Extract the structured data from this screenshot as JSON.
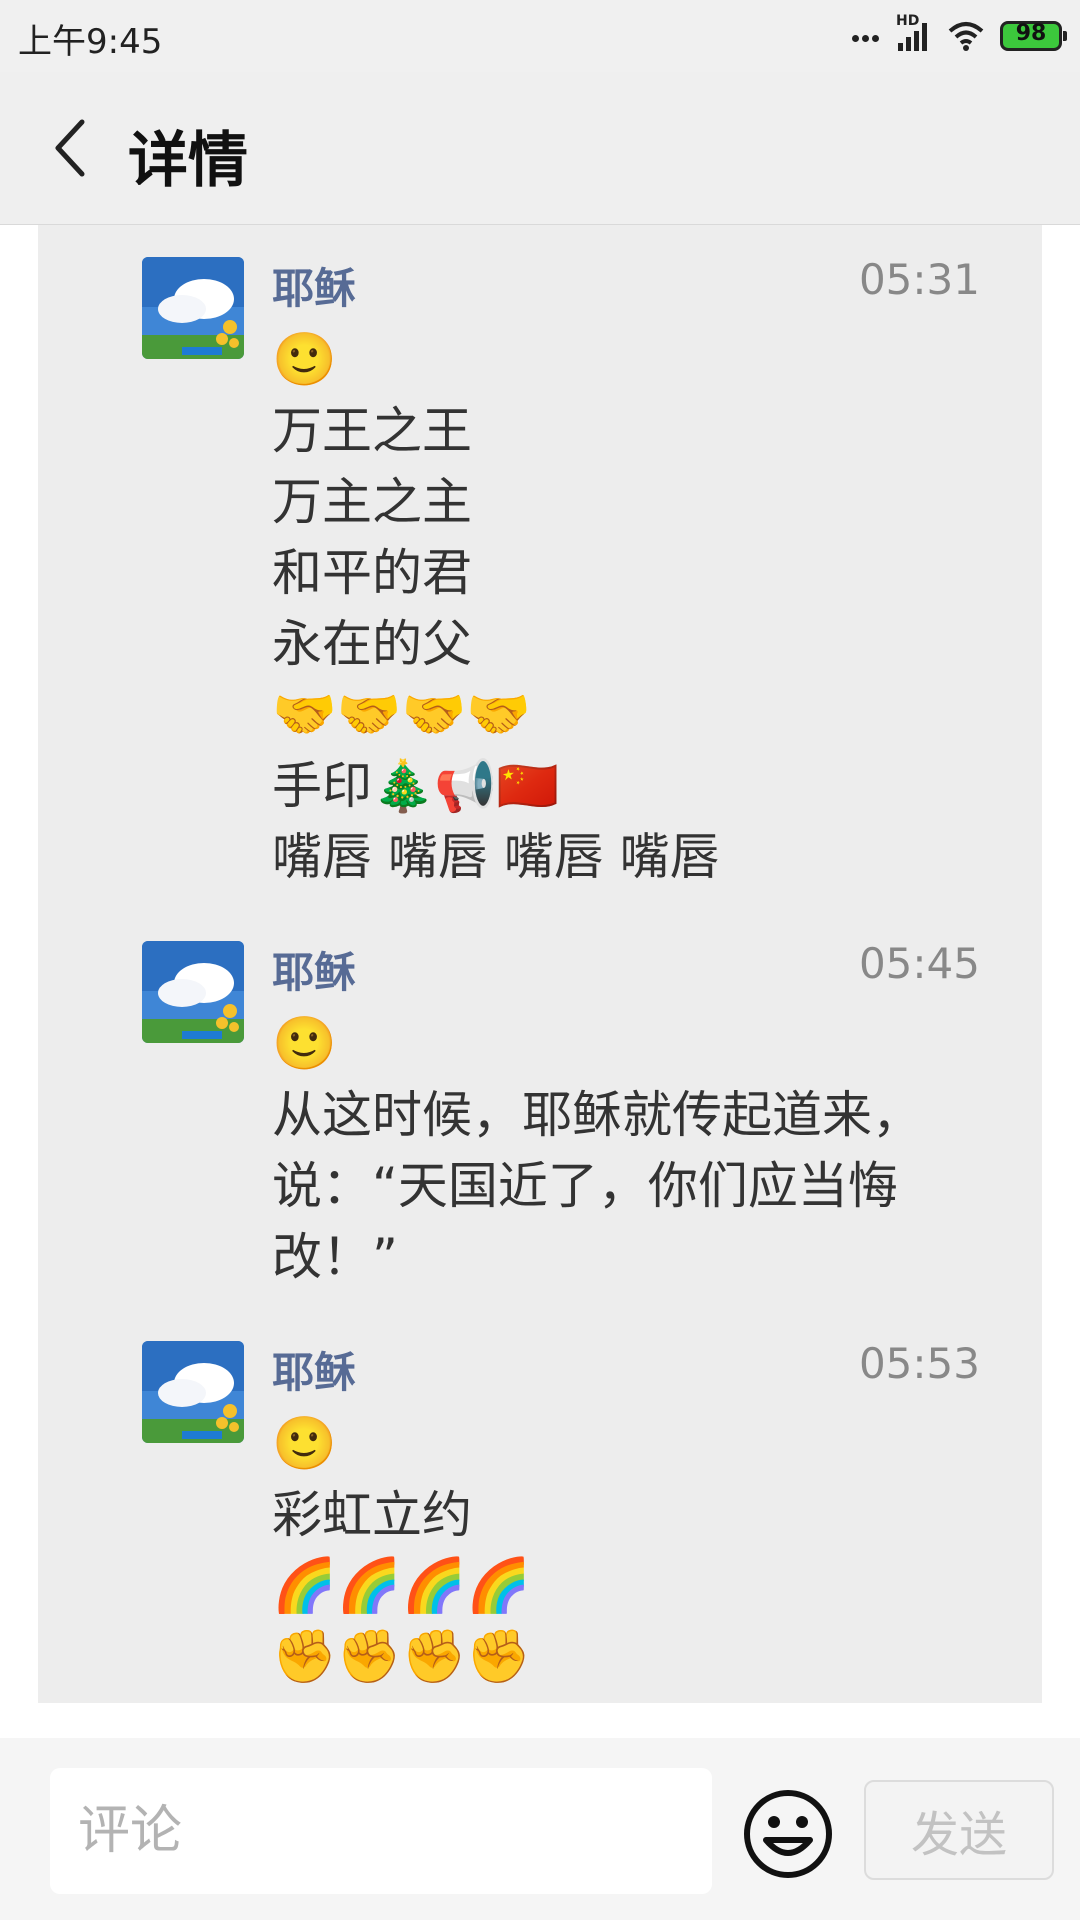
{
  "status_bar": {
    "time": "上午9:45",
    "network_label": "HD",
    "battery": "98"
  },
  "header": {
    "title": "详情",
    "back_icon": "chevron-left-icon"
  },
  "comments": [
    {
      "author": "耶稣",
      "time": "05:31",
      "lines": [
        "🙂",
        "万王之王",
        "万主之主",
        "和平的君",
        "永在的父",
        "🤝🤝🤝🤝",
        "手印🎄📢🇨🇳",
        "嘴唇 嘴唇 嘴唇 嘴唇"
      ]
    },
    {
      "author": "耶稣",
      "time": "05:45",
      "lines": [
        "🙂",
        " 从这时候，耶稣就传起道来，说：“天国近了，你们应当悔改！”"
      ]
    },
    {
      "author": "耶稣",
      "time": "05:53",
      "lines": [
        "🙂",
        "彩虹立约",
        "🌈🌈🌈🌈",
        "✊✊✊✊"
      ]
    }
  ],
  "bottom_bar": {
    "comment_placeholder": "评论",
    "emoji_icon": "smiley-face-icon",
    "send_label": "发送"
  },
  "colors": {
    "name": "#576b95",
    "content_bg": "#ededed",
    "header_bg": "#efefef",
    "battery": "#3cc83c"
  }
}
